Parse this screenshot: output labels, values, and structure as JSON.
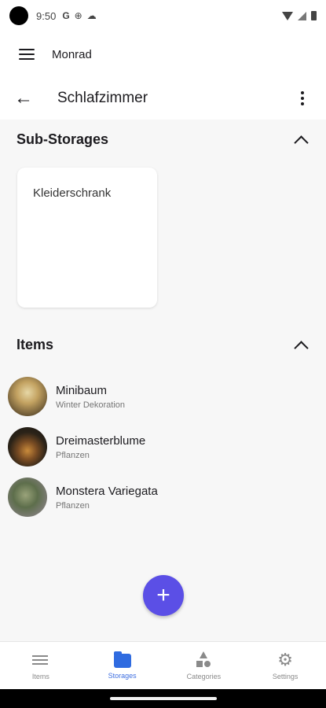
{
  "status_bar": {
    "time": "9:50",
    "google_glyph": "G"
  },
  "home_bar": {
    "title": "Monrad"
  },
  "storage_bar": {
    "title": "Schlafzimmer"
  },
  "sub_storages": {
    "title": "Sub-Storages",
    "cards": [
      {
        "name": "Kleiderschrank"
      }
    ]
  },
  "items": {
    "title": "Items",
    "list": [
      {
        "name": "Minibaum",
        "category": "Winter Dekoration",
        "icon": "photo-avatar"
      },
      {
        "name": "Dreimasterblume",
        "category": "Pflanzen",
        "icon": "photo-avatar"
      },
      {
        "name": "Monstera Variegata",
        "category": "Pflanzen",
        "icon": "photo-avatar"
      }
    ]
  },
  "fab": {
    "symbol": "+",
    "color": "#5b4fe6"
  },
  "bottom_nav": {
    "active": "Storages",
    "active_color": "#3f6fe0",
    "tabs": [
      {
        "label": "Items",
        "icon": "list-icon"
      },
      {
        "label": "Storages",
        "icon": "folder-icon"
      },
      {
        "label": "Categories",
        "icon": "shapes-icon"
      },
      {
        "label": "Settings",
        "icon": "gear-icon"
      }
    ]
  }
}
